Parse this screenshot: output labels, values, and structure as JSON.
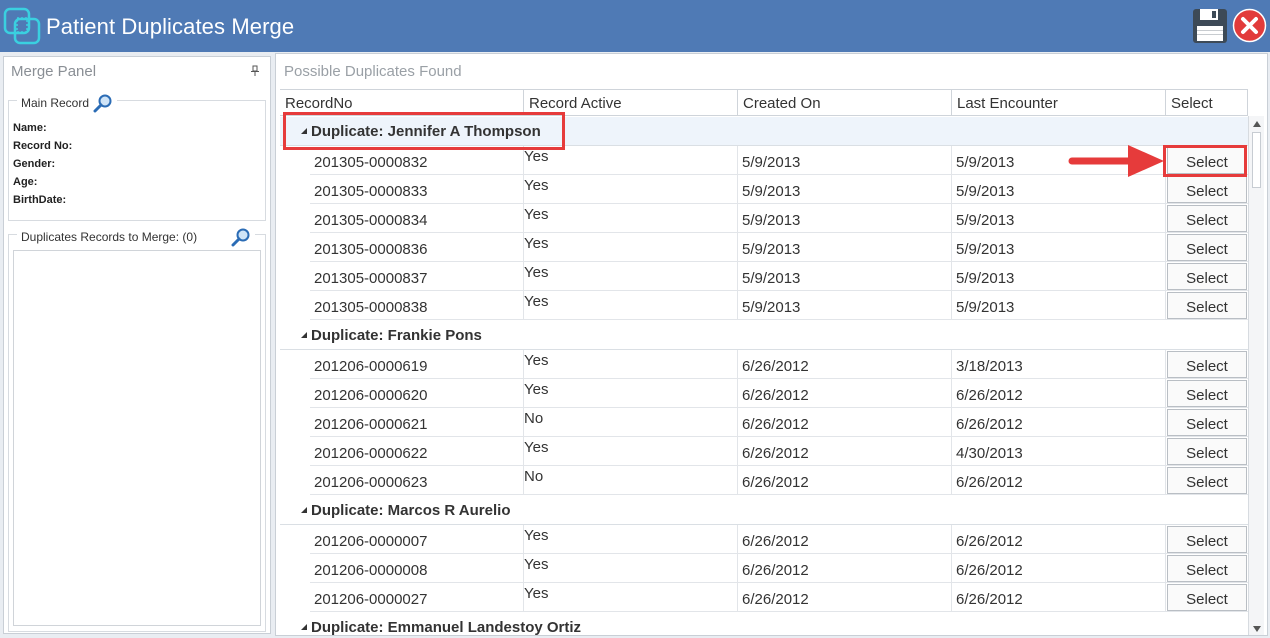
{
  "window": {
    "title": "Patient Duplicates Merge"
  },
  "merge_panel": {
    "title": "Merge Panel",
    "main_record": {
      "legend": "Main Record",
      "fields": [
        "Name:",
        "Record No:",
        "Gender:",
        "Age:",
        "BirthDate:"
      ]
    },
    "duplicates": {
      "legend": "Duplicates Records to Merge: (0)"
    }
  },
  "grid": {
    "title": "Possible Duplicates Found",
    "columns": [
      "RecordNo",
      "Record Active",
      "Created On",
      "Last Encounter",
      "Select"
    ],
    "select_label": "Select",
    "groups": [
      {
        "label": "Duplicate: Jennifer A Thompson",
        "rows": [
          {
            "record_no": "201305-0000832",
            "active": "Yes",
            "created_on": "5/9/2013",
            "last_encounter": "5/9/2013"
          },
          {
            "record_no": "201305-0000833",
            "active": "Yes",
            "created_on": "5/9/2013",
            "last_encounter": "5/9/2013"
          },
          {
            "record_no": "201305-0000834",
            "active": "Yes",
            "created_on": "5/9/2013",
            "last_encounter": "5/9/2013"
          },
          {
            "record_no": "201305-0000836",
            "active": "Yes",
            "created_on": "5/9/2013",
            "last_encounter": "5/9/2013"
          },
          {
            "record_no": "201305-0000837",
            "active": "Yes",
            "created_on": "5/9/2013",
            "last_encounter": "5/9/2013"
          },
          {
            "record_no": "201305-0000838",
            "active": "Yes",
            "created_on": "5/9/2013",
            "last_encounter": "5/9/2013"
          }
        ]
      },
      {
        "label": "Duplicate: Frankie Pons",
        "rows": [
          {
            "record_no": "201206-0000619",
            "active": "Yes",
            "created_on": "6/26/2012",
            "last_encounter": "3/18/2013"
          },
          {
            "record_no": "201206-0000620",
            "active": "Yes",
            "created_on": "6/26/2012",
            "last_encounter": "6/26/2012"
          },
          {
            "record_no": "201206-0000621",
            "active": "No",
            "created_on": "6/26/2012",
            "last_encounter": "6/26/2012"
          },
          {
            "record_no": "201206-0000622",
            "active": "Yes",
            "created_on": "6/26/2012",
            "last_encounter": "4/30/2013"
          },
          {
            "record_no": "201206-0000623",
            "active": "No",
            "created_on": "6/26/2012",
            "last_encounter": "6/26/2012"
          }
        ]
      },
      {
        "label": "Duplicate: Marcos R Aurelio",
        "rows": [
          {
            "record_no": "201206-0000007",
            "active": "Yes",
            "created_on": "6/26/2012",
            "last_encounter": "6/26/2012"
          },
          {
            "record_no": "201206-0000008",
            "active": "Yes",
            "created_on": "6/26/2012",
            "last_encounter": "6/26/2012"
          },
          {
            "record_no": "201206-0000027",
            "active": "Yes",
            "created_on": "6/26/2012",
            "last_encounter": "6/26/2012"
          }
        ]
      },
      {
        "label": "Duplicate: Emmanuel Landestoy Ortiz",
        "rows": []
      }
    ]
  },
  "colors": {
    "titlebar": "#4f7ab5",
    "highlight": "#e63b3b"
  },
  "icons": [
    "app-logo-icon",
    "save-icon",
    "close-icon",
    "pin-icon",
    "search-icon",
    "collapse-triangle-icon"
  ]
}
